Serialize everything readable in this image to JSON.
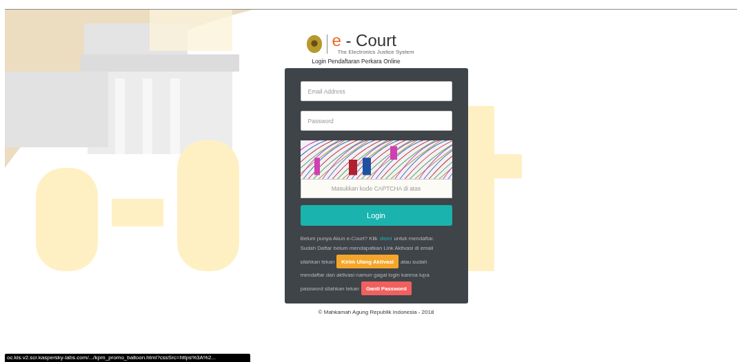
{
  "logo": {
    "title_e": "e",
    "title_rest": "- Court",
    "subtitle": "The Electronics Justice System"
  },
  "heading": "Login Pendaftaran Perkara Online",
  "form": {
    "email": {
      "placeholder": "Email Address"
    },
    "password": {
      "placeholder": "Password"
    },
    "captcha": {
      "placeholder": "Masukkan kode CAPTCHA di atas"
    },
    "login_button": "Login"
  },
  "help": [
    {
      "kind": "text",
      "text": "Belum punya Akun e-Court? Klik"
    },
    {
      "kind": "link",
      "text": "disini"
    },
    {
      "kind": "text",
      "text": "untuk mendaftar."
    },
    {
      "kind": "text",
      "text": "Sudah Daftar belum mendapatkan Link Aktivasi di email"
    },
    {
      "kind": "text",
      "text": "silahkan tekan"
    },
    {
      "kind": "button",
      "text": "Kirim Ulang Aktivasi",
      "color": "#f5a62a"
    },
    {
      "kind": "text",
      "text": "atau sudah"
    },
    {
      "kind": "text",
      "text": "mendaftar dan aktivasi namun gagal login karena lupa"
    },
    {
      "kind": "text",
      "text": "password silahkan tekan"
    },
    {
      "kind": "button",
      "text": "Ganti Password",
      "color": "#f0605e"
    }
  ],
  "footer": "© Mahkamah Agung Republik Indonesia - 2018",
  "status_url": "oc.kis.v2.scr.kaspersky-labs.com/.../kpm_promo_balloon.html?cssSrc=https%3A%2..."
}
